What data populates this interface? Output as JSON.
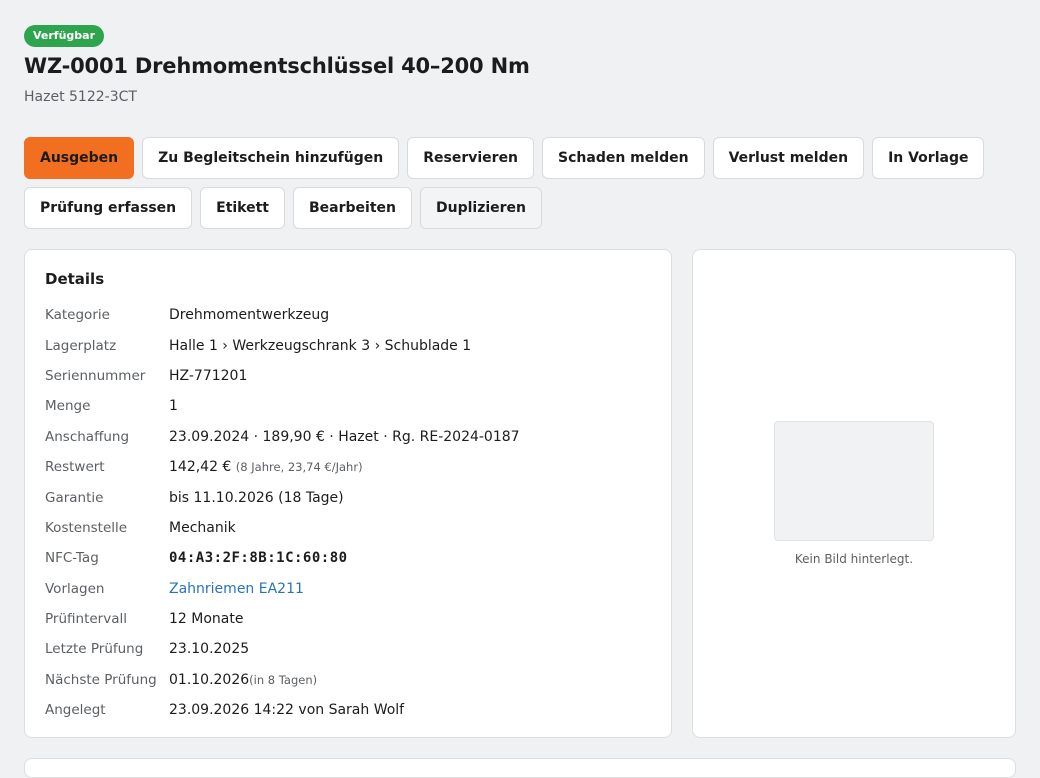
{
  "status_badge": "Verfügbar",
  "title": "WZ-0001 Drehmomentschlüssel 40–200 Nm",
  "subtitle": "Hazet 5122-3CT",
  "actions_row1": {
    "issue": "Ausgeben",
    "add_to_slip": "Zu Begleitschein hinzufügen",
    "reserve": "Reservieren",
    "report_damage": "Schaden melden",
    "report_loss": "Verlust melden",
    "template": "In Vorlage"
  },
  "actions_row2": {
    "inspection": "Prüfung erfassen",
    "label": "Etikett",
    "edit": "Bearbeiten",
    "duplicate": "Duplizieren"
  },
  "details": {
    "heading": "Details",
    "category_label": "Kategorie",
    "category_value": "Drehmomentwerkzeug",
    "location_label": "Lagerplatz",
    "location_value": "Halle 1 › Werkzeugschrank 3 › Schublade 1",
    "serial_label": "Seriennummer",
    "serial_value": "HZ-771201",
    "quantity_label": "Menge",
    "quantity_value": "1",
    "purchase_label": "Anschaffung",
    "purchase_value": "23.09.2024 · 189,90 € · Hazet · Rg. RE-2024-0187",
    "residual_label": "Restwert",
    "residual_value": "142,42 €",
    "residual_note": "(8 Jahre, 23,74 €/Jahr)",
    "warranty_label": "Garantie",
    "warranty_value": "bis 11.10.2026 (18 Tage)",
    "costcenter_label": "Kostenstelle",
    "costcenter_value": "Mechanik",
    "nfc_label": "NFC-Tag",
    "nfc_value": "04:A3:2F:8B:1C:60:80",
    "templates_label": "Vorlagen",
    "templates_value": "Zahnriemen EA211",
    "interval_label": "Prüfintervall",
    "interval_value": "12 Monate",
    "last_check_label": "Letzte Prüfung",
    "last_check_value": "23.10.2025",
    "next_check_label": "Nächste Prüfung",
    "next_check_value": "01.10.2026",
    "next_check_note": "(in 8 Tagen)",
    "created_label": "Angelegt",
    "created_value": "23.09.2026 14:22 von Sarah Wolf"
  },
  "image": {
    "empty_text": "Kein Bild hinterlegt."
  },
  "colors": {
    "badge": "#2ea44f",
    "primary_button": "#f26f21",
    "link": "#2873b8"
  }
}
